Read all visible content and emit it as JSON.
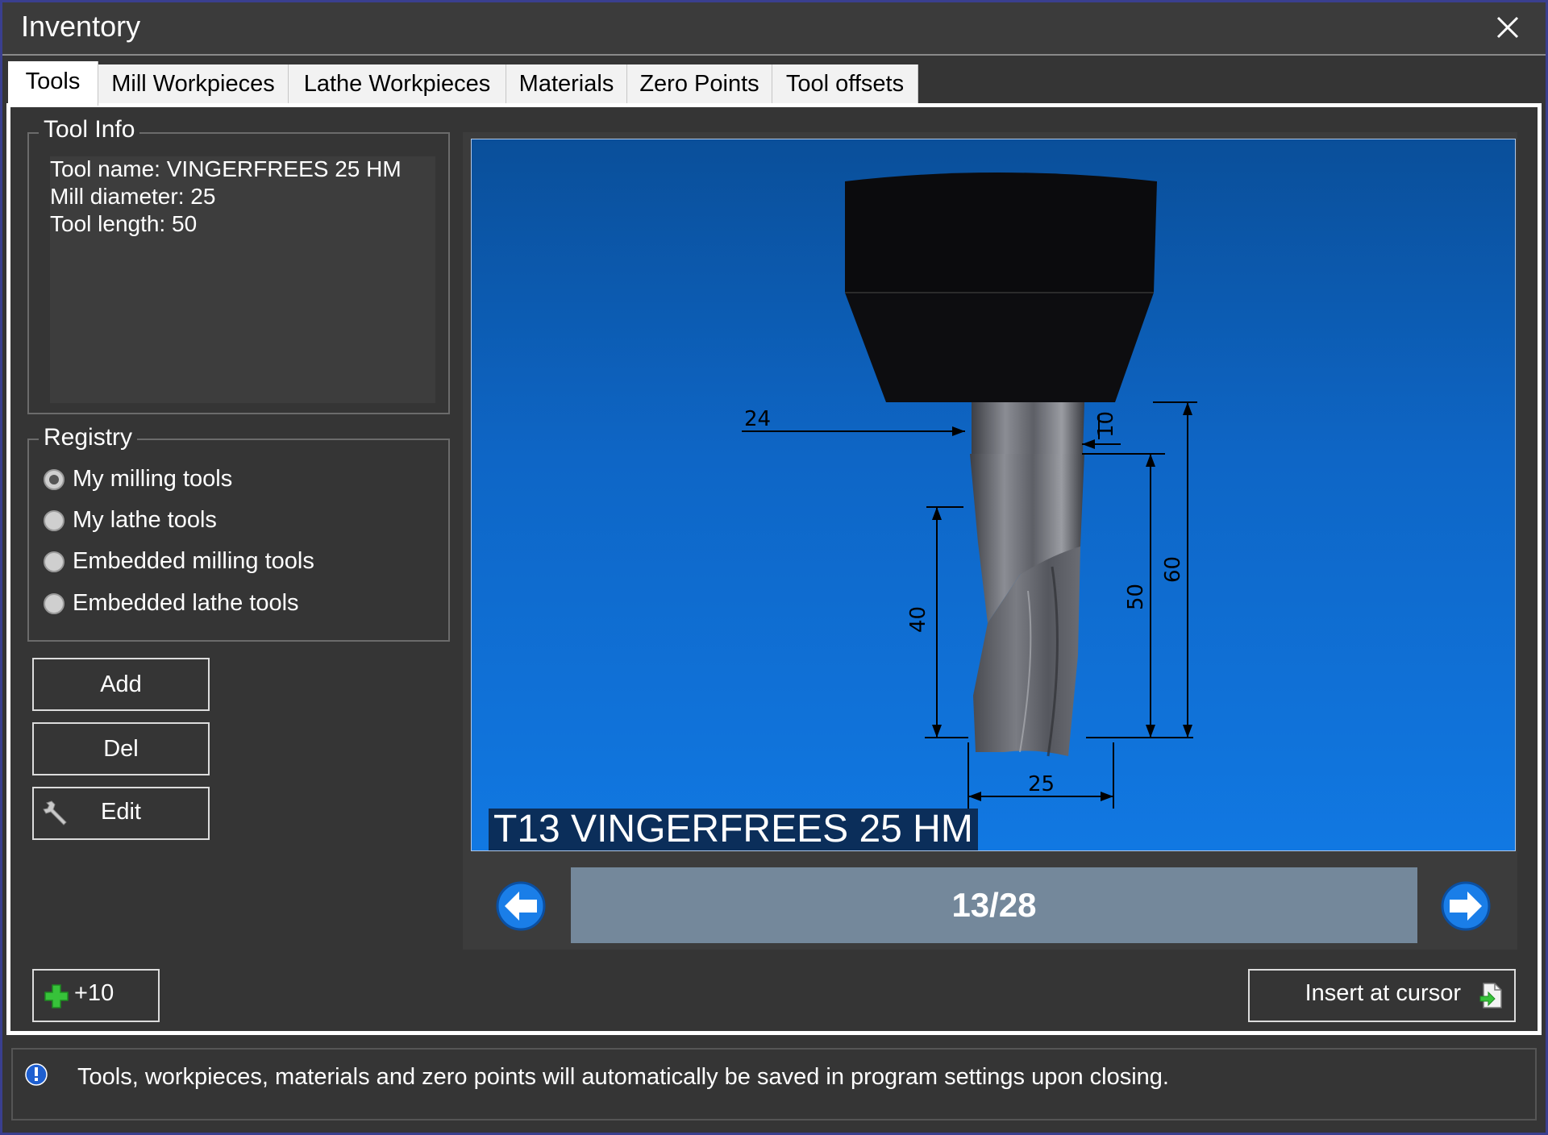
{
  "window": {
    "title": "Inventory"
  },
  "tabs": [
    {
      "label": "Tools",
      "active": true
    },
    {
      "label": "Mill Workpieces",
      "active": false
    },
    {
      "label": "Lathe Workpieces",
      "active": false
    },
    {
      "label": "Materials",
      "active": false
    },
    {
      "label": "Zero Points",
      "active": false
    },
    {
      "label": "Tool offsets",
      "active": false
    }
  ],
  "tool_info": {
    "legend": "Tool Info",
    "lines": [
      "Tool name: VINGERFREES 25 HM",
      "Mill diameter: 25",
      "Tool length: 50"
    ]
  },
  "registry": {
    "legend": "Registry",
    "options": [
      {
        "label": "My milling tools",
        "checked": true
      },
      {
        "label": "My lathe tools",
        "checked": false
      },
      {
        "label": "Embedded milling tools",
        "checked": false
      },
      {
        "label": "Embedded lathe tools",
        "checked": false
      }
    ]
  },
  "buttons": {
    "add": "Add",
    "del": "Del",
    "edit": "Edit",
    "plus10": "+10",
    "insert": "Insert at cursor"
  },
  "viewer": {
    "caption": "T13 VINGERFREES 25 HM",
    "dimensions": {
      "d24": "24",
      "d10": "10",
      "d40": "40",
      "d50": "50",
      "d60": "60",
      "d25": "25"
    }
  },
  "pager": {
    "position": "13/28",
    "current": 13,
    "total": 28
  },
  "status": {
    "message": "Tools, workpieces, materials and zero points will automatically be saved in program settings upon closing."
  },
  "colors": {
    "accent_blue": "#1178e2",
    "pager_bg": "#74889b",
    "green_plus": "#37c23a",
    "window_border": "#3a3f8f"
  },
  "icons": {
    "close": "close-icon",
    "edit": "wrench-icon",
    "plus": "plus-icon",
    "insert": "insert-document-icon",
    "prev": "arrow-left-icon",
    "next": "arrow-right-icon",
    "info": "info-icon"
  }
}
